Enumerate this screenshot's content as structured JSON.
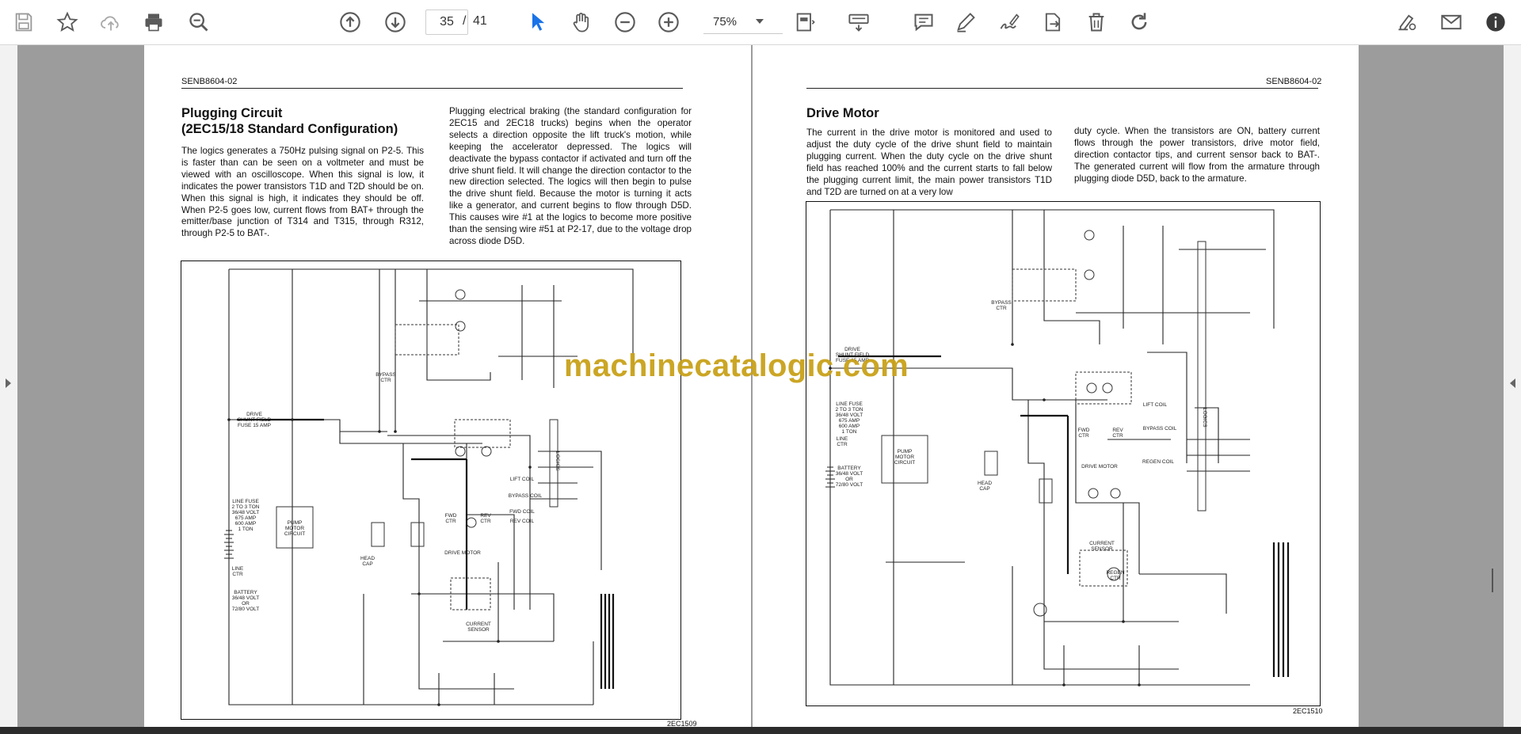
{
  "toolbar": {
    "page_current": "35",
    "page_separator": "/",
    "page_total": "41",
    "zoom_value": "75%",
    "colors": {
      "icon": "#5a5a5a",
      "active": "#1a73e8"
    },
    "icons_left": [
      "save-icon",
      "bookmark-star-icon",
      "cloud-upload-icon",
      "print-icon",
      "zoom-search-icon"
    ],
    "icons_nav": [
      "page-up-icon",
      "page-down-icon"
    ],
    "icons_tools": [
      "select-arrow-icon",
      "hand-pan-icon",
      "zoom-out-icon",
      "zoom-in-icon"
    ],
    "icons_right": [
      "fit-page-icon",
      "keyboard-icon",
      "comment-icon",
      "pen-icon",
      "sign-icon",
      "export-icon",
      "delete-icon",
      "rotate-icon",
      "share-edit-icon",
      "email-icon",
      "info-icon"
    ]
  },
  "left_page": {
    "doc_code": "SENB8604-02",
    "title": "Plugging Circuit\n(2EC15/18 Standard Configuration)",
    "col1": "The logics generates a 750Hz pulsing signal on P2-5. This is faster than can be seen on a voltmeter and must be viewed with an oscilloscope. When this signal is low, it indicates the power transistors T1D and T2D should be on. When this signal is high, it indicates they should be off. When P2-5 goes low, current flows from BAT+ through the emitter/base junction of T314 and T315, through R312, through P2-5 to BAT-.",
    "col2": "Plugging electrical braking (the standard configuration for 2EC15 and 2EC18 trucks) begins when the operator selects a direction opposite the lift truck's motion, while keeping the accelerator depressed. The logics will deactivate the bypass contactor if activated and turn off the drive shunt field. It will change the direction contactor to the new direction selected. The logics will then begin to pulse the drive shunt field. Because the motor is turning it acts like a generator, and current begins to flow through D5D. This causes wire #1 at the logics to become more positive than the sensing wire #51 at P2-17, due to the voltage drop across diode D5D.",
    "figure_id": "2EC1509",
    "labels": {
      "drive_fuse": "DRIVE\nSHUNT FIELD\nFUSE 15 AMP",
      "line_fuse": "LINE FUSE\n2 TO 3 TON\n36/48 VOLT\n675 AMP\n600 AMP\n1 TON",
      "line_ctr": "LINE\nCTR",
      "battery": "BATTERY\n36/48 VOLT\nOR\n72/80 VOLT",
      "pump_motor": "PUMP\nMOTOR\nCIRCUIT",
      "head_cap": "HEAD\nCAP",
      "bypass": "BYPASS\nCTR",
      "drive_motor": "DRIVE MOTOR",
      "current_sensor": "CURRENT\nSENSOR",
      "logics": "LOGICS",
      "lift_coil": "LIFT COIL",
      "bypass_coil": "BYPASS COIL",
      "fwd_coil": "FWD COIL",
      "rev_coil": "REV COIL",
      "fwd_ctr": "FWD\nCTR",
      "rev_ctr": "REV\nCTR"
    }
  },
  "right_page": {
    "doc_code": "SENB8604-02",
    "title": "Drive Motor",
    "col1": "The current in the drive motor is monitored and used to adjust the duty cycle of the drive shunt field to maintain plugging current. When the duty cycle on the drive shunt field has reached 100% and the current starts to fall below the plugging current limit, the main power transistors T1D and T2D are turned on at a very low",
    "col2": "duty cycle. When the transistors are ON, battery current flows through the power transistors, drive motor field, direction contactor tips, and current sensor back to BAT-. The generated current will flow from the armature through plugging diode D5D, back to the armature.",
    "figure_id": "2EC1510",
    "labels": {
      "drive_fuse": "DRIVE\nSHUNT FIELD\nFUSE 15 AMP",
      "line_fuse": "LINE FUSE\n2 TO 3 TON\n36/48 VOLT\n675 AMP\n600 AMP\n1 TON",
      "line_ctr": "LINE\nCTR",
      "battery": "BATTERY\n36/48 VOLT\nOR\n72/80 VOLT",
      "pump_motor": "PUMP\nMOTOR\nCIRCUIT",
      "head_cap": "HEAD\nCAP",
      "bypass": "BYPASS\nCTR",
      "drive_motor": "DRIVE MOTOR",
      "current_sensor": "CURRENT\nSENSOR",
      "logics": "LOGICS",
      "regen_ctr": "REGEN\nCTR",
      "lift_coil": "LIFT COIL",
      "bypass_coil": "BYPASS COIL",
      "regen_coil": "REGEN COIL",
      "fwd_ctr": "FWD\nCTR",
      "rev_ctr": "REV\nCTR"
    }
  },
  "watermark": "machinecatalogic.com"
}
